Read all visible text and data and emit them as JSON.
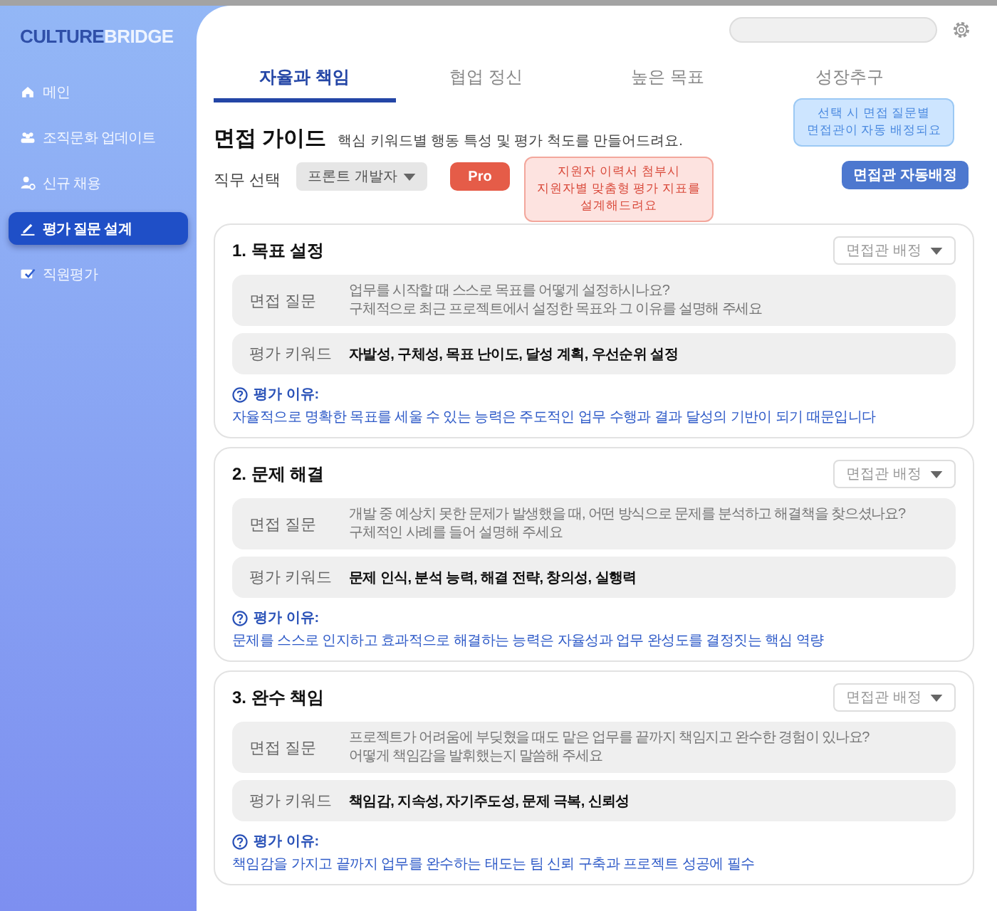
{
  "brand": {
    "strong": "CULTURE",
    "light": "BRIDGE"
  },
  "sidebar": {
    "items": [
      {
        "label": "메인",
        "kind": "home",
        "selected": false
      },
      {
        "label": "조직문화 업데이트",
        "kind": "team",
        "selected": false
      },
      {
        "label": "신규 채용",
        "kind": "person",
        "selected": false
      },
      {
        "label": "평가 질문 설계",
        "kind": "pen",
        "selected": true
      },
      {
        "label": "직원평가",
        "kind": "check",
        "selected": false
      }
    ]
  },
  "tabs": [
    {
      "label": "자율과 책임",
      "selected": true
    },
    {
      "label": "협업 정신",
      "selected": false
    },
    {
      "label": "높은 목표",
      "selected": false
    },
    {
      "label": "성장추구",
      "selected": false
    }
  ],
  "guide": {
    "title": "면접 가이드",
    "description": "핵심 키워드별 행동 특성 및 평가 척도를 만들어드려요.",
    "job_label": "직무 선택",
    "job_value": "프론트 개발자",
    "pro_button": "Pro",
    "pro_tooltip": [
      "지원자 이력서 첨부시",
      "지원자별 맞춤형 평가 지표를",
      "설계해드려요"
    ],
    "auto_tooltip": [
      "선택 시 면접 질문별",
      "면접관이 자동 배정되요"
    ],
    "auto_button": "면접관 자동배정"
  },
  "cards": [
    {
      "title": "1. 목표 설정",
      "assign_placeholder": "면접관 배정",
      "question_label": "면접 질문",
      "question": [
        "업무를 시작할 때 스스로 목표를 어떻게 설정하시나요?",
        "구체적으로 최근 프로젝트에서 설정한 목표와 그 이유를 설명해 주세요"
      ],
      "keyword_label": "평가 키워드",
      "keywords": "자발성, 구체성, 목표 난이도, 달성 계획, 우선순위 설정",
      "reason_label": "평가 이유:",
      "reason": "자율적으로 명확한 목표를 세울 수 있는 능력은 주도적인 업무 수행과 결과 달성의 기반이 되기 때문입니다"
    },
    {
      "title": "2. 문제 해결",
      "assign_placeholder": "면접관 배정",
      "question_label": "면접 질문",
      "question": [
        "개발 중 예상치 못한 문제가 발생했을 때, 어떤 방식으로 문제를 분석하고 해결책을 찾으셨나요?",
        "구체적인 사례를 들어 설명해 주세요"
      ],
      "keyword_label": "평가 키워드",
      "keywords": "문제 인식, 분석 능력, 해결 전략, 창의성, 실행력",
      "reason_label": "평가 이유:",
      "reason": "문제를 스스로 인지하고 효과적으로 해결하는 능력은 자율성과 업무 완성도를 결정짓는 핵심 역량"
    },
    {
      "title": "3. 완수 책임",
      "assign_placeholder": "면접관 배정",
      "question_label": "면접 질문",
      "question": [
        "프로젝트가 어려움에 부딪혔을 때도 맡은 업무를 끝까지 책임지고 완수한 경험이 있나요?",
        "어떻게 책임감을 발휘했는지 말씀해 주세요"
      ],
      "keyword_label": "평가 키워드",
      "keywords": "책임감, 지속성, 자기주도성, 문제 극복, 신뢰성",
      "reason_label": "평가 이유:",
      "reason": "책임감을 가지고 끝까지 업무를 완수하는 태도는 팀 신뢰 구축과 프로젝트 성공에 필수"
    }
  ]
}
